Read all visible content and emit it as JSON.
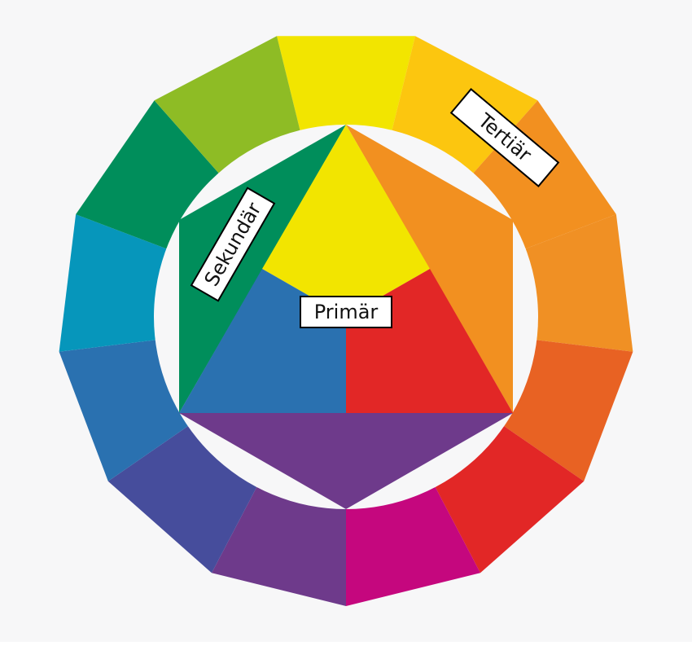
{
  "background": "#f7f7f8",
  "ring": {
    "segments": [
      {
        "name": "yellow",
        "color": "#f2e500"
      },
      {
        "name": "yellow-orange",
        "color": "#fcc60f"
      },
      {
        "name": "orange-yellow",
        "color": "#f29020"
      },
      {
        "name": "orange",
        "color": "#f09024"
      },
      {
        "name": "red-orange",
        "color": "#e86223"
      },
      {
        "name": "red",
        "color": "#e22726"
      },
      {
        "name": "magenta",
        "color": "#c5077e"
      },
      {
        "name": "violet",
        "color": "#6e3a8b"
      },
      {
        "name": "blue-violet",
        "color": "#464d9c"
      },
      {
        "name": "blue",
        "color": "#2a71b0"
      },
      {
        "name": "cyan-blue",
        "color": "#0696bb"
      },
      {
        "name": "green",
        "color": "#008e5b"
      },
      {
        "name": "yellow-green",
        "color": "#8ebc25"
      }
    ]
  },
  "inner": {
    "primary": {
      "yellow": "#f2e500",
      "red": "#e22726",
      "blue": "#2a71b0"
    },
    "secondary": {
      "orange": "#f29020",
      "violet": "#6e3a8b",
      "green": "#008e5b"
    }
  },
  "labels": {
    "primary": "Primär",
    "secondary": "Sekundär",
    "tertiary": "Tertiär"
  }
}
